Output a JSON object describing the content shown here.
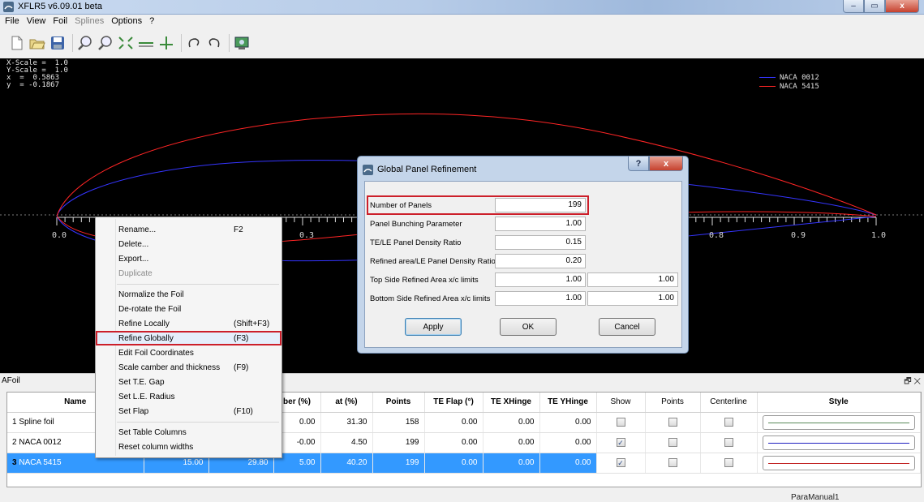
{
  "window": {
    "title": "XFLR5 v6.09.01 beta",
    "min": "‒",
    "max": "▭",
    "close": "x"
  },
  "menu": [
    {
      "label": "File",
      "disabled": false
    },
    {
      "label": "View",
      "disabled": false
    },
    {
      "label": "Foil",
      "disabled": false
    },
    {
      "label": "Splines",
      "disabled": true
    },
    {
      "label": "Options",
      "disabled": false
    },
    {
      "label": "?",
      "disabled": false
    }
  ],
  "toolbar_icons": [
    "new-file-icon",
    "open-folder-icon",
    "save-icon",
    "zoom-in-icon",
    "zoom-out-icon",
    "reset-scale-icon",
    "reset-x-scale-icon",
    "reset-y-scale-icon",
    "undo-icon",
    "redo-icon",
    "store-picture-icon"
  ],
  "plot": {
    "readout": {
      "xscale": "X-Scale =  1.0",
      "yscale": "Y-Scale =  1.0",
      "x": "x  =  0.5863",
      "y": "y  = -0.1867"
    },
    "legend": [
      {
        "name": "NACA 0012",
        "color": "#3030ff"
      },
      {
        "name": "NACA 5415",
        "color": "#ff2020"
      }
    ],
    "tick_labels": [
      "0.0",
      "0.3",
      "0.8",
      "0.9",
      "1.0"
    ]
  },
  "context_menu": {
    "items": [
      {
        "label": "Rename...",
        "shortcut": "F2"
      },
      {
        "label": "Delete...",
        "shortcut": ""
      },
      {
        "label": "Export...",
        "shortcut": ""
      },
      {
        "label": "Duplicate",
        "shortcut": "",
        "disabled": true
      },
      {
        "label": "Normalize the Foil",
        "shortcut": ""
      },
      {
        "label": "De-rotate the Foil",
        "shortcut": ""
      },
      {
        "label": "Refine Locally",
        "shortcut": "(Shift+F3)"
      },
      {
        "label": "Refine Globally",
        "shortcut": "(F3)",
        "highlight": true
      },
      {
        "label": "Edit Foil Coordinates",
        "shortcut": ""
      },
      {
        "label": "Scale camber and thickness",
        "shortcut": "(F9)"
      },
      {
        "label": "Set T.E. Gap",
        "shortcut": ""
      },
      {
        "label": "Set L.E. Radius",
        "shortcut": ""
      },
      {
        "label": "Set Flap",
        "shortcut": "(F10)"
      },
      {
        "label": "Set Table Columns",
        "shortcut": ""
      },
      {
        "label": "Reset column widths",
        "shortcut": ""
      }
    ]
  },
  "dialog": {
    "title": "Global Panel Refinement",
    "help": "?",
    "close": "x",
    "rows": [
      {
        "label": "Number of Panels",
        "value": "199",
        "value2": ""
      },
      {
        "label": "Panel Bunching Parameter",
        "value": "1.00",
        "value2": ""
      },
      {
        "label": "TE/LE Panel Density Ratio",
        "value": "0.15",
        "value2": ""
      },
      {
        "label": "Refined area/LE Panel Density Ratio",
        "value": "0.20",
        "value2": ""
      },
      {
        "label": "Top Side Refined Area x/c limits",
        "value": "1.00",
        "value2": "1.00"
      },
      {
        "label": "Bottom Side Refined Area x/c limits",
        "value": "1.00",
        "value2": "1.00"
      }
    ],
    "buttons": {
      "apply": "Apply",
      "ok": "OK",
      "cancel": "Cancel"
    }
  },
  "afoil": {
    "title": "AFoil",
    "float_close": "🗗 ✕",
    "columns": [
      "Name",
      "",
      "",
      "ber (%)",
      "at (%)",
      "Points",
      "TE Flap (°)",
      "TE XHinge",
      "TE YHinge",
      "Show",
      "Points",
      "Centerline",
      "Style"
    ],
    "rows": [
      {
        "index": "1",
        "name": "Spline foil",
        "c1": "",
        "c2": "",
        "camber": "0.00",
        "at": "31.30",
        "points": "158",
        "flap": "0.00",
        "xh": "0.00",
        "yh": "0.00",
        "show": "",
        "pts": "",
        "center": "",
        "style_color": "#5a8a5a"
      },
      {
        "index": "2",
        "name": "NACA 0012",
        "c1": "",
        "c2": "",
        "camber": "-0.00",
        "at": "4.50",
        "points": "199",
        "flap": "0.00",
        "xh": "0.00",
        "yh": "0.00",
        "show": "✓",
        "pts": "",
        "center": "",
        "style_color": "#2020c0"
      },
      {
        "index": "3",
        "name": "NACA 5415",
        "c1": "15.00",
        "c2": "29.80",
        "camber": "5.00",
        "at": "40.20",
        "points": "199",
        "flap": "0.00",
        "xh": "0.00",
        "yh": "0.00",
        "show": "✓",
        "pts": "",
        "center": "",
        "style_color": "#c02020"
      }
    ]
  },
  "status": "ParaManual1"
}
